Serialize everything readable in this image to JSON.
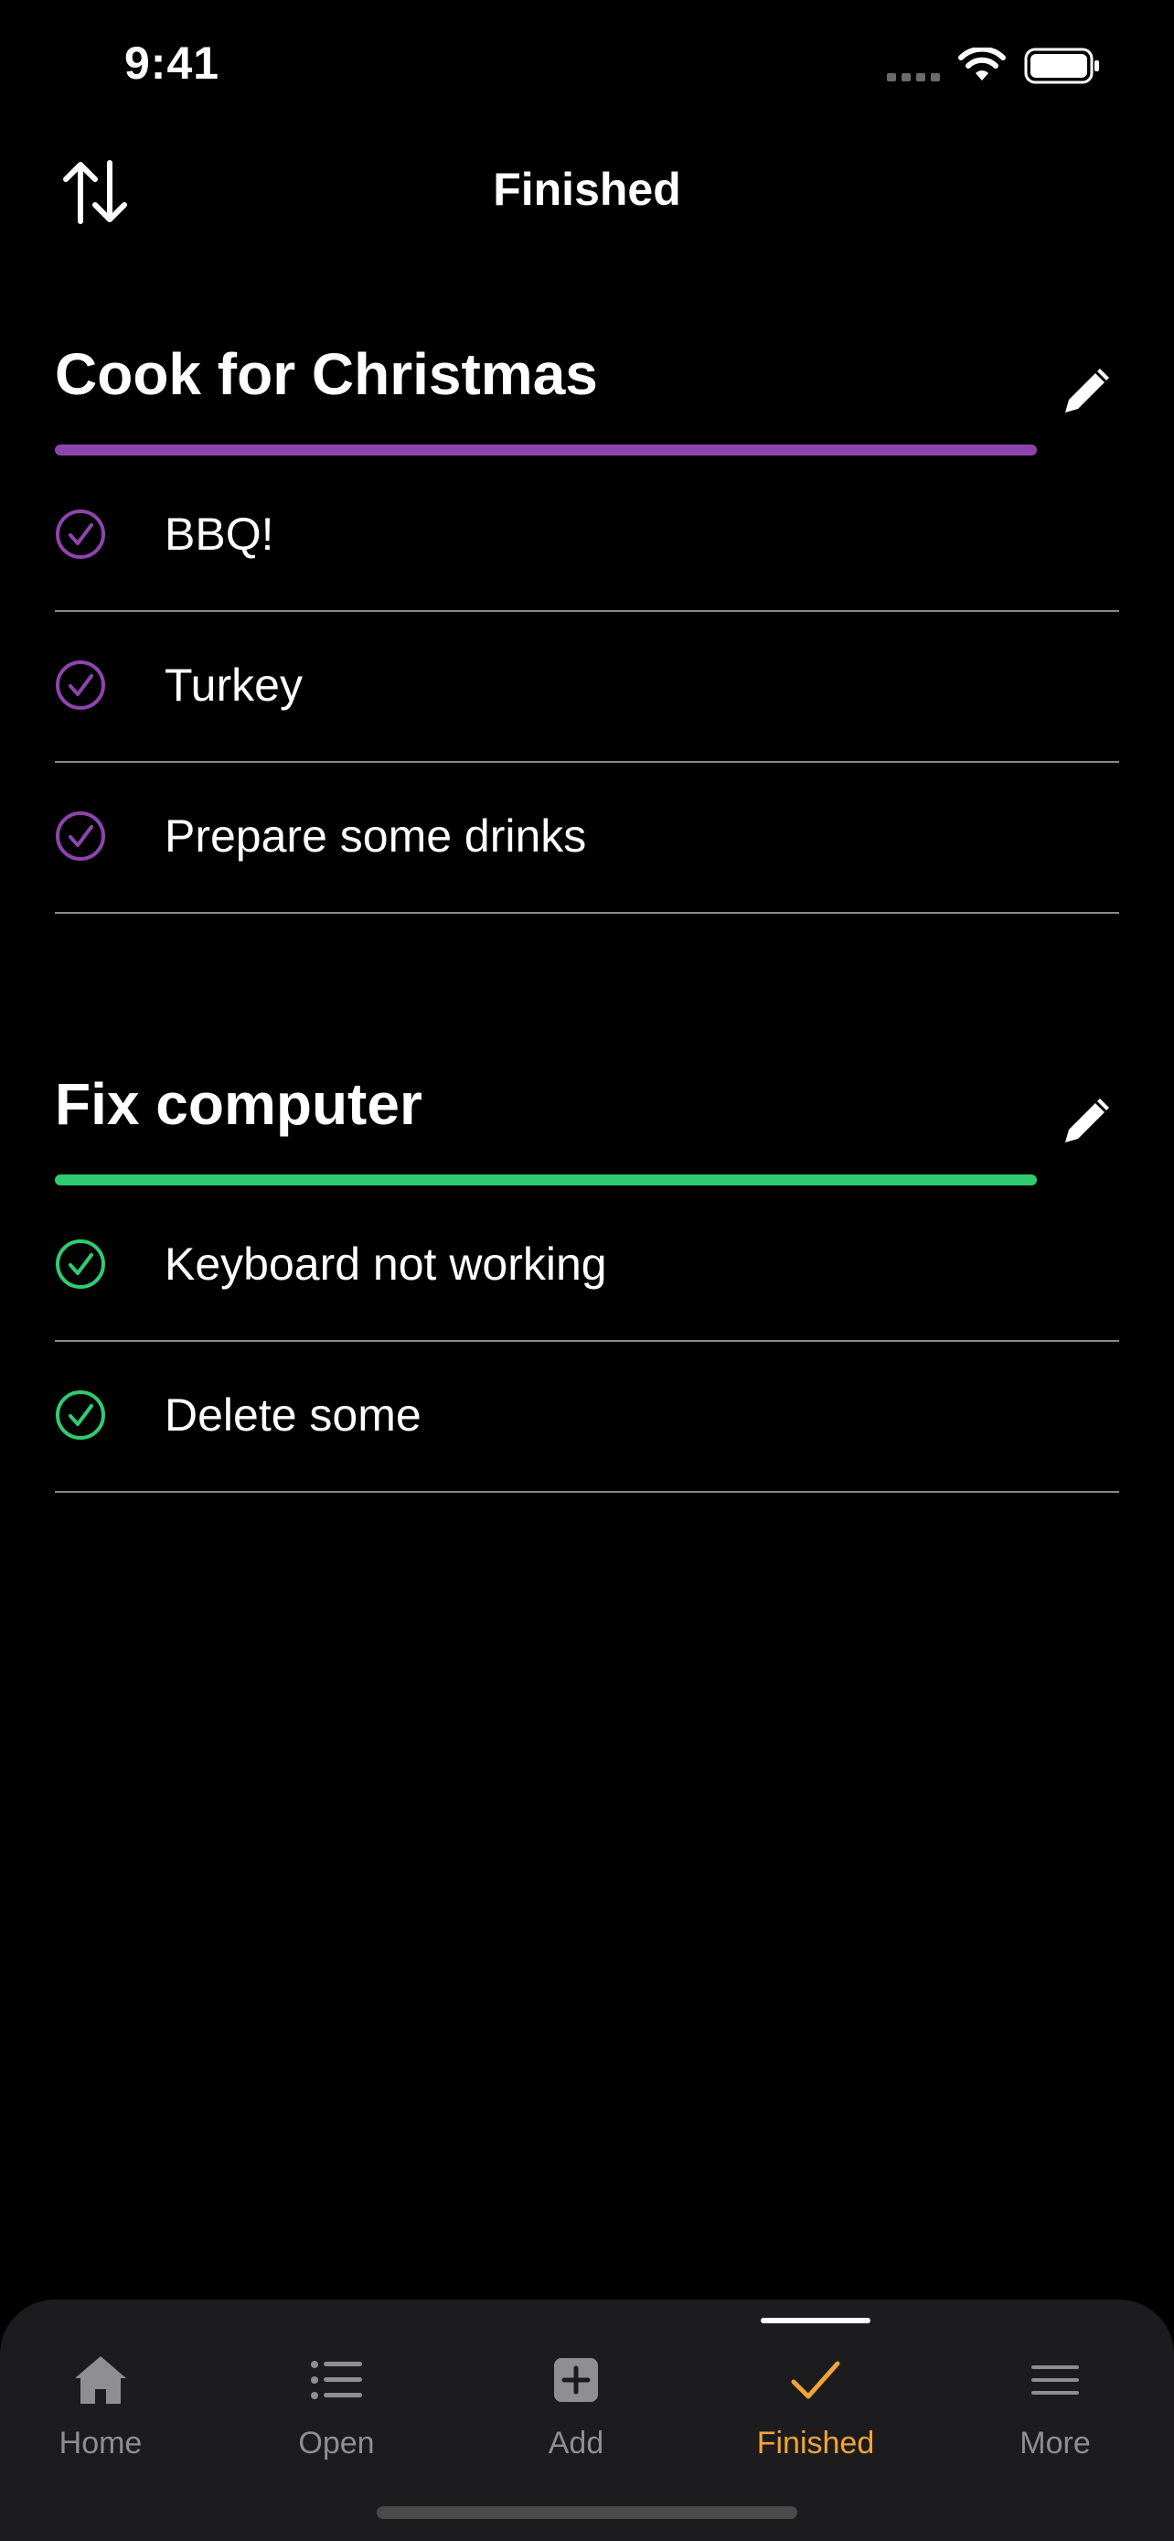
{
  "status_bar": {
    "time": "9:41"
  },
  "nav": {
    "title": "Finished",
    "sort_icon": "sort-arrows-icon"
  },
  "groups": [
    {
      "title": "Cook for Christmas",
      "color": "#8e44ad",
      "progress": 1.0,
      "items": [
        {
          "label": "BBQ!"
        },
        {
          "label": "Turkey"
        },
        {
          "label": "Prepare some drinks"
        }
      ]
    },
    {
      "title": "Fix computer",
      "color": "#2ecc71",
      "progress": 1.0,
      "items": [
        {
          "label": "Keyboard not working"
        },
        {
          "label": "Delete some"
        }
      ]
    }
  ],
  "tabs": [
    {
      "label": "Home",
      "icon": "house-icon",
      "active": false
    },
    {
      "label": "Open",
      "icon": "list-icon",
      "active": false
    },
    {
      "label": "Add",
      "icon": "plus-square-icon",
      "active": false
    },
    {
      "label": "Finished",
      "icon": "checkmark-icon",
      "active": true
    },
    {
      "label": "More",
      "icon": "menu-icon",
      "active": false
    }
  ],
  "colors": {
    "accent": "#f2a33a",
    "inactive": "#8e8e93"
  }
}
